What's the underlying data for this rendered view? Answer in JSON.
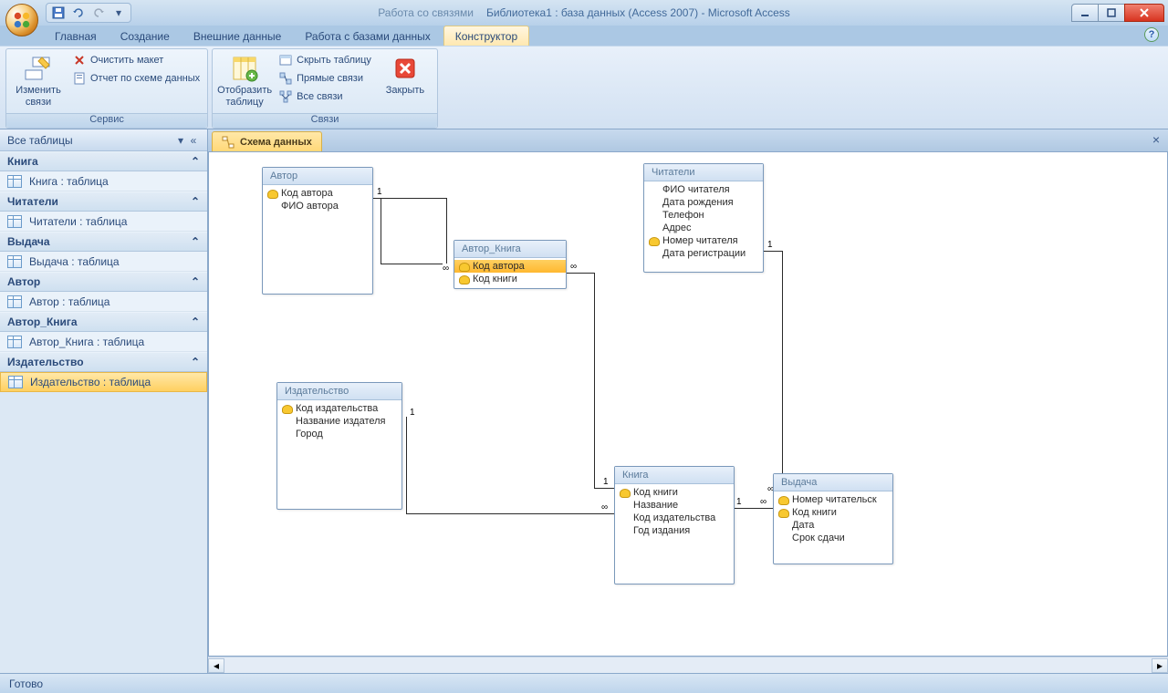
{
  "title": {
    "context": "Работа со связями",
    "document": "Библиотека1 : база данных (Access 2007) - Microsoft Access"
  },
  "ribbonTabs": {
    "home": "Главная",
    "create": "Создание",
    "external": "Внешние данные",
    "dbtools": "Работа с базами данных",
    "designer": "Конструктор"
  },
  "ribbon": {
    "group1": {
      "label": "Сервис",
      "editRel": "Изменить связи",
      "clearLayout": "Очистить макет",
      "report": "Отчет по схеме данных"
    },
    "group2": {
      "label": "Связи",
      "showTable": "Отобразить таблицу",
      "hideTable": "Скрыть таблицу",
      "directRel": "Прямые связи",
      "allRel": "Все связи",
      "close": "Закрыть"
    }
  },
  "nav": {
    "header": "Все таблицы",
    "groups": [
      {
        "name": "Книга",
        "item": "Книга : таблица"
      },
      {
        "name": "Читатели",
        "item": "Читатели : таблица"
      },
      {
        "name": "Выдача",
        "item": "Выдача : таблица"
      },
      {
        "name": "Автор",
        "item": "Автор : таблица"
      },
      {
        "name": "Автор_Книга",
        "item": "Автор_Книга : таблица"
      },
      {
        "name": "Издательство",
        "item": "Издательство : таблица"
      }
    ]
  },
  "docTab": "Схема данных",
  "entities": {
    "avtor": {
      "title": "Автор",
      "f0": "Код автора",
      "f1": "ФИО автора"
    },
    "avtorKniga": {
      "title": "Автор_Книга",
      "f0": "Код автора",
      "f1": "Код книги"
    },
    "chitateli": {
      "title": "Читатели",
      "f0": "ФИО читателя",
      "f1": "Дата рождения",
      "f2": "Телефон",
      "f3": "Адрес",
      "f4": "Номер  читателя",
      "f5": "Дата регистрации"
    },
    "izdatelstvo": {
      "title": "Издательство",
      "f0": "Код издательства",
      "f1": "Название издателя",
      "f2": "Город"
    },
    "kniga": {
      "title": "Книга",
      "f0": "Код книги",
      "f1": "Название",
      "f2": "Код издательства",
      "f3": "Год издания"
    },
    "vydacha": {
      "title": "Выдача",
      "f0": "Номер читательск",
      "f1": "Код книги",
      "f2": "Дата",
      "f3": "Срок сдачи"
    }
  },
  "relLabels": {
    "one": "1",
    "many": "∞"
  },
  "status": "Готово"
}
